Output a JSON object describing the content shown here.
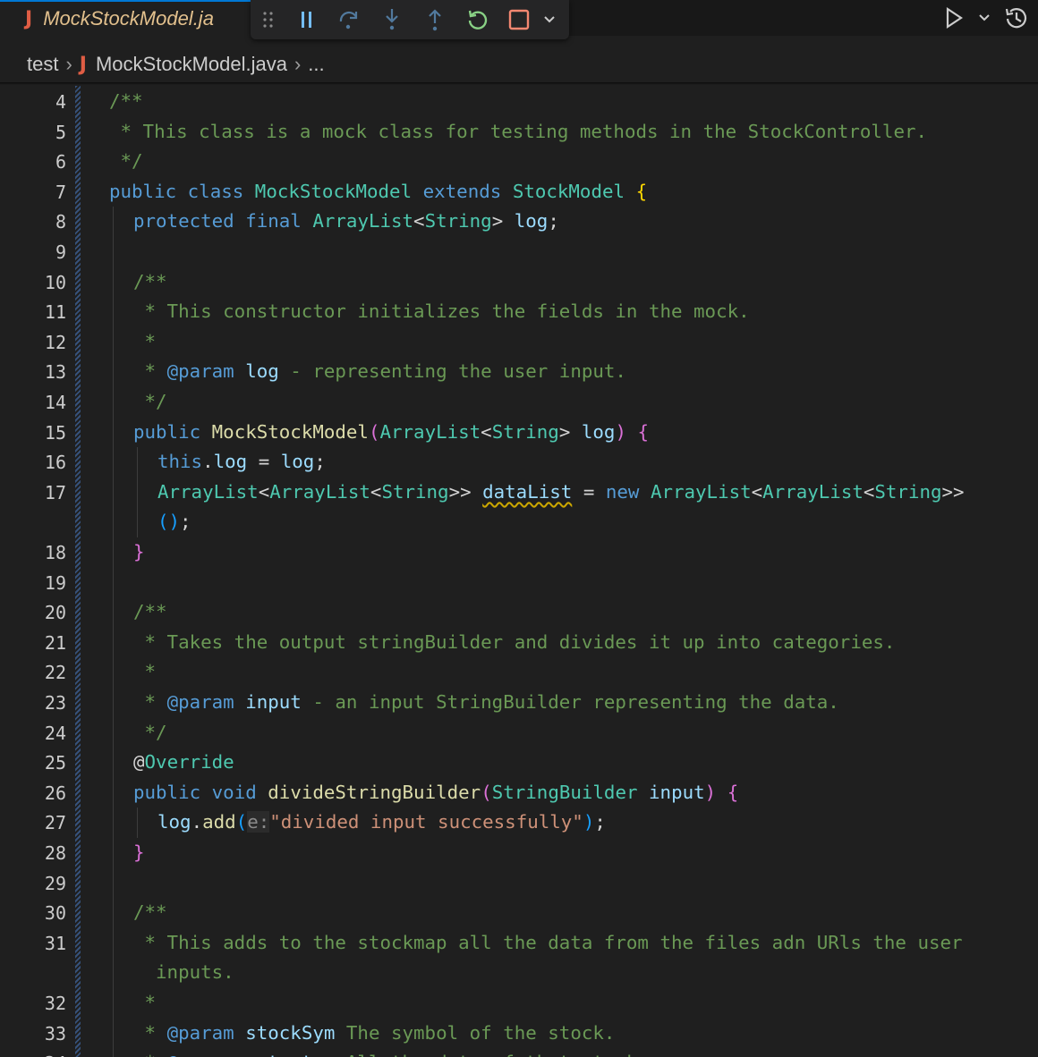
{
  "tab": {
    "icon": "java-file-icon",
    "icon_glyph": "J",
    "label": "MockStockModel.ja"
  },
  "debug_toolbar": {
    "buttons": [
      {
        "name": "drag-handle-icon"
      },
      {
        "name": "pause-icon"
      },
      {
        "name": "step-over-icon"
      },
      {
        "name": "step-into-icon"
      },
      {
        "name": "step-out-icon"
      },
      {
        "name": "restart-icon"
      },
      {
        "name": "stop-icon"
      },
      {
        "name": "chevron-down-icon"
      }
    ]
  },
  "actions": {
    "run_icon": "run-icon",
    "history_icon": "history-icon"
  },
  "breadcrumb": {
    "folder": "test",
    "file_icon_glyph": "J",
    "file": "MockStockModel.java",
    "more": "..."
  },
  "colors": {
    "background": "#1f1f1f",
    "comment": "#6a9955",
    "keyword": "#569cd6",
    "type": "#4ec9b0",
    "function": "#dcdcaa",
    "variable": "#9cdcfe",
    "string": "#ce9178",
    "tab_label": "#e2c08d",
    "java_icon": "#e05d44"
  },
  "editor": {
    "lines": [
      {
        "n": "4",
        "indent": 0,
        "tokens": [
          [
            "c-comment",
            "/**"
          ]
        ]
      },
      {
        "n": "5",
        "indent": 0,
        "tokens": [
          [
            "c-comment",
            " * This class is a mock class for testing methods in the StockController."
          ]
        ]
      },
      {
        "n": "6",
        "indent": 0,
        "tokens": [
          [
            "c-comment",
            " */"
          ]
        ]
      },
      {
        "n": "7",
        "indent": 0,
        "tokens": [
          [
            "c-kw",
            "public"
          ],
          [
            "c-plain",
            " "
          ],
          [
            "c-kw",
            "class"
          ],
          [
            "c-plain",
            " "
          ],
          [
            "c-type",
            "MockStockModel"
          ],
          [
            "c-plain",
            " "
          ],
          [
            "c-kw",
            "extends"
          ],
          [
            "c-plain",
            " "
          ],
          [
            "c-type",
            "StockModel"
          ],
          [
            "c-plain",
            " "
          ],
          [
            "c-p1",
            "{"
          ]
        ]
      },
      {
        "n": "8",
        "indent": 1,
        "tokens": [
          [
            "c-kw",
            "protected"
          ],
          [
            "c-plain",
            " "
          ],
          [
            "c-kw",
            "final"
          ],
          [
            "c-plain",
            " "
          ],
          [
            "c-type",
            "ArrayList"
          ],
          [
            "c-plain",
            "<"
          ],
          [
            "c-type",
            "String"
          ],
          [
            "c-plain",
            "> "
          ],
          [
            "c-var",
            "log"
          ],
          [
            "c-plain",
            ";"
          ]
        ]
      },
      {
        "n": "9",
        "indent": 1,
        "tokens": []
      },
      {
        "n": "10",
        "indent": 1,
        "tokens": [
          [
            "c-comment",
            "/**"
          ]
        ]
      },
      {
        "n": "11",
        "indent": 1,
        "tokens": [
          [
            "c-comment",
            " * This constructor initializes the fields in the mock."
          ]
        ]
      },
      {
        "n": "12",
        "indent": 1,
        "tokens": [
          [
            "c-comment",
            " *"
          ]
        ]
      },
      {
        "n": "13",
        "indent": 1,
        "tokens": [
          [
            "c-comment",
            " * "
          ],
          [
            "c-doc",
            "@param"
          ],
          [
            "c-plain",
            " "
          ],
          [
            "c-var",
            "log"
          ],
          [
            "c-comment",
            " - representing the user input."
          ]
        ]
      },
      {
        "n": "14",
        "indent": 1,
        "tokens": [
          [
            "c-comment",
            " */"
          ]
        ]
      },
      {
        "n": "15",
        "indent": 1,
        "tokens": [
          [
            "c-kw",
            "public"
          ],
          [
            "c-plain",
            " "
          ],
          [
            "c-fn",
            "MockStockModel"
          ],
          [
            "c-p2",
            "("
          ],
          [
            "c-type",
            "ArrayList"
          ],
          [
            "c-plain",
            "<"
          ],
          [
            "c-type",
            "String"
          ],
          [
            "c-plain",
            "> "
          ],
          [
            "c-var",
            "log"
          ],
          [
            "c-p2",
            ")"
          ],
          [
            "c-plain",
            " "
          ],
          [
            "c-p2",
            "{"
          ]
        ]
      },
      {
        "n": "16",
        "indent": 2,
        "tokens": [
          [
            "c-kw",
            "this"
          ],
          [
            "c-plain",
            "."
          ],
          [
            "c-var",
            "log"
          ],
          [
            "c-plain",
            " = "
          ],
          [
            "c-var",
            "log"
          ],
          [
            "c-plain",
            ";"
          ]
        ]
      },
      {
        "n": "17",
        "indent": 2,
        "tokens": [
          [
            "c-type",
            "ArrayList"
          ],
          [
            "c-plain",
            "<"
          ],
          [
            "c-type",
            "ArrayList"
          ],
          [
            "c-plain",
            "<"
          ],
          [
            "c-type",
            "String"
          ],
          [
            "c-plain",
            ">> "
          ],
          [
            "c-var squiggle",
            "dataList"
          ],
          [
            "c-plain",
            " = "
          ],
          [
            "c-kw",
            "new"
          ],
          [
            "c-plain",
            " "
          ],
          [
            "c-type",
            "ArrayList"
          ],
          [
            "c-plain",
            "<"
          ],
          [
            "c-type",
            "ArrayList"
          ],
          [
            "c-plain",
            "<"
          ],
          [
            "c-type",
            "String"
          ],
          [
            "c-plain",
            ">>"
          ]
        ]
      },
      {
        "n": "",
        "indent": 2,
        "tokens": [
          [
            "c-p3",
            "()"
          ],
          [
            "c-plain",
            ";"
          ]
        ]
      },
      {
        "n": "18",
        "indent": 1,
        "tokens": [
          [
            "c-p2",
            "}"
          ]
        ]
      },
      {
        "n": "19",
        "indent": 1,
        "tokens": []
      },
      {
        "n": "20",
        "indent": 1,
        "tokens": [
          [
            "c-comment",
            "/**"
          ]
        ]
      },
      {
        "n": "21",
        "indent": 1,
        "tokens": [
          [
            "c-comment",
            " * Takes the output stringBuilder and divides it up into categories."
          ]
        ]
      },
      {
        "n": "22",
        "indent": 1,
        "tokens": [
          [
            "c-comment",
            " *"
          ]
        ]
      },
      {
        "n": "23",
        "indent": 1,
        "tokens": [
          [
            "c-comment",
            " * "
          ],
          [
            "c-doc",
            "@param"
          ],
          [
            "c-plain",
            " "
          ],
          [
            "c-var",
            "input"
          ],
          [
            "c-comment",
            " - an input StringBuilder representing the data."
          ]
        ]
      },
      {
        "n": "24",
        "indent": 1,
        "tokens": [
          [
            "c-comment",
            " */"
          ]
        ]
      },
      {
        "n": "25",
        "indent": 1,
        "tokens": [
          [
            "c-plain",
            "@"
          ],
          [
            "c-type",
            "Override"
          ]
        ]
      },
      {
        "n": "26",
        "indent": 1,
        "tokens": [
          [
            "c-kw",
            "public"
          ],
          [
            "c-plain",
            " "
          ],
          [
            "c-kw",
            "void"
          ],
          [
            "c-plain",
            " "
          ],
          [
            "c-fn",
            "divideStringBuilder"
          ],
          [
            "c-p2",
            "("
          ],
          [
            "c-type",
            "StringBuilder"
          ],
          [
            "c-plain",
            " "
          ],
          [
            "c-var",
            "input"
          ],
          [
            "c-p2",
            ")"
          ],
          [
            "c-plain",
            " "
          ],
          [
            "c-p2",
            "{"
          ]
        ]
      },
      {
        "n": "27",
        "indent": 2,
        "tokens": [
          [
            "c-var",
            "log"
          ],
          [
            "c-plain",
            "."
          ],
          [
            "c-fn",
            "add"
          ],
          [
            "c-p3",
            "("
          ],
          [
            "c-hint",
            "e:"
          ],
          [
            "c-str",
            "\"divided input successfully\""
          ],
          [
            "c-p3",
            ")"
          ],
          [
            "c-plain",
            ";"
          ]
        ]
      },
      {
        "n": "28",
        "indent": 1,
        "tokens": [
          [
            "c-p2",
            "}"
          ]
        ]
      },
      {
        "n": "29",
        "indent": 1,
        "tokens": []
      },
      {
        "n": "30",
        "indent": 1,
        "tokens": [
          [
            "c-comment",
            "/**"
          ]
        ]
      },
      {
        "n": "31",
        "indent": 1,
        "tokens": [
          [
            "c-comment",
            " * This adds to the stockmap all the data from the files adn URls the user"
          ]
        ]
      },
      {
        "n": "",
        "indent": 1,
        "tokens": [
          [
            "c-comment",
            "  inputs."
          ]
        ]
      },
      {
        "n": "32",
        "indent": 1,
        "tokens": [
          [
            "c-comment",
            " *"
          ]
        ]
      },
      {
        "n": "33",
        "indent": 1,
        "tokens": [
          [
            "c-comment",
            " * "
          ],
          [
            "c-doc",
            "@param"
          ],
          [
            "c-plain",
            " "
          ],
          [
            "c-var",
            "stockSym"
          ],
          [
            "c-comment",
            " The symbol of the stock."
          ]
        ]
      },
      {
        "n": "34",
        "indent": 1,
        "tokens": [
          [
            "c-comment",
            " * "
          ],
          [
            "c-doc",
            "@param"
          ],
          [
            "c-plain",
            " "
          ],
          [
            "c-var",
            "output"
          ],
          [
            "c-comment",
            " - All the data of that stock."
          ]
        ]
      }
    ]
  }
}
